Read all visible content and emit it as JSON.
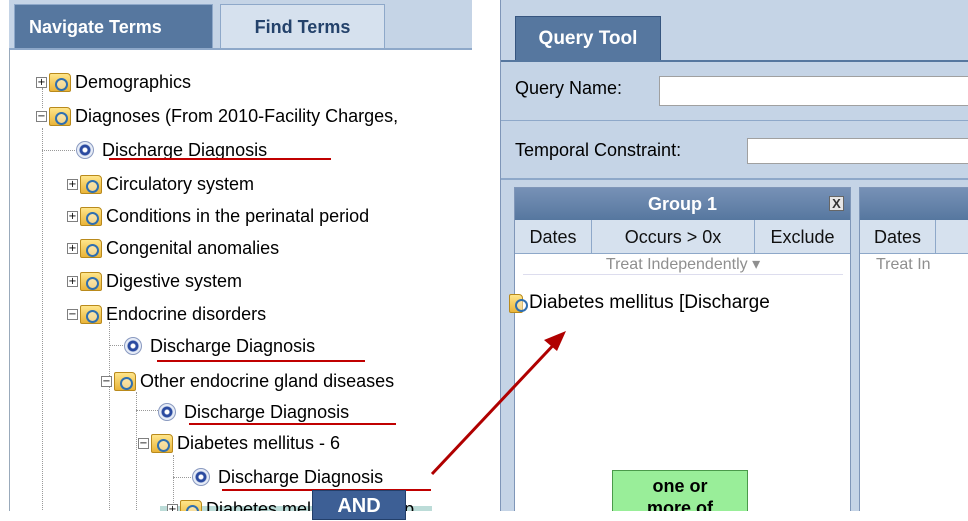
{
  "left_panel": {
    "tabs": [
      "Navigate Terms",
      "Find Terms"
    ],
    "tree": [
      {
        "label": "Demographics",
        "type": "folder",
        "expander": "+"
      },
      {
        "label": "Diagnoses (From 2010-Facility Charges,",
        "type": "folder",
        "expander": "−"
      },
      {
        "label": "Discharge Diagnosis",
        "type": "leaf"
      },
      {
        "label": "Circulatory system",
        "type": "folder",
        "expander": "+"
      },
      {
        "label": "Conditions in the perinatal period",
        "type": "folder",
        "expander": "+"
      },
      {
        "label": "Congenital anomalies",
        "type": "folder",
        "expander": "+"
      },
      {
        "label": "Digestive system",
        "type": "folder",
        "expander": "+"
      },
      {
        "label": "Endocrine disorders",
        "type": "folder",
        "expander": "−"
      },
      {
        "label": "Discharge Diagnosis",
        "type": "leaf"
      },
      {
        "label": "Other endocrine gland diseases",
        "type": "folder",
        "expander": "−"
      },
      {
        "label": "Discharge Diagnosis",
        "type": "leaf"
      },
      {
        "label": "Diabetes mellitus - 6",
        "type": "folder",
        "expander": "−"
      },
      {
        "label": "Discharge Diagnosis",
        "type": "leaf"
      },
      {
        "label": "Diabetes mellitus with hyp",
        "type": "folder",
        "expander": "+"
      }
    ]
  },
  "query_tool": {
    "tab": "Query Tool",
    "query_name_label": "Query Name:",
    "query_name_value": "",
    "temporal_label": "Temporal Constraint:",
    "temporal_value": "",
    "group1": {
      "title": "Group 1",
      "close": "X",
      "toolbar": [
        "Dates",
        "Occurs > 0x",
        "Exclude"
      ],
      "treat": "Treat Independently ▾",
      "item": "Diabetes mellitus [Discharge",
      "one_or_more": [
        "one or",
        "more of"
      ]
    },
    "group2": {
      "toolbar": [
        "Dates"
      ],
      "treat": "Treat In"
    },
    "and_label": "AND"
  },
  "colors": {
    "tab_active": "#56779f",
    "panel_bg": "#c5d4e6",
    "underline": "#c00000",
    "arrow": "#b00000",
    "selected_row": "#bcdcd8",
    "one_or_more_bg": "#99ee99",
    "and_bg": "#3d5f95"
  }
}
